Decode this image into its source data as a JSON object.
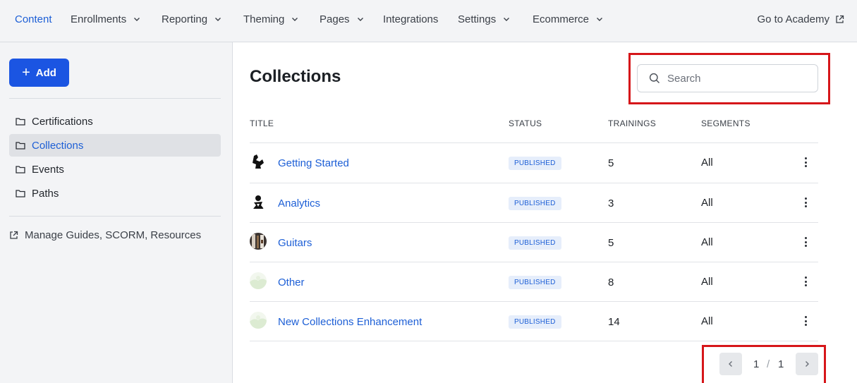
{
  "nav": {
    "items": [
      {
        "label": "Content",
        "active": true,
        "dropdown": false
      },
      {
        "label": "Enrollments",
        "dropdown": true
      },
      {
        "label": "Reporting",
        "dropdown": true
      },
      {
        "label": "Theming",
        "dropdown": true
      },
      {
        "label": "Pages",
        "dropdown": true
      },
      {
        "label": "Integrations",
        "dropdown": false
      },
      {
        "label": "Settings",
        "dropdown": true
      },
      {
        "label": "Ecommerce",
        "dropdown": true
      }
    ],
    "external_link": "Go to Academy"
  },
  "sidebar": {
    "add_label": "Add",
    "items": [
      {
        "label": "Certifications",
        "active": false
      },
      {
        "label": "Collections",
        "active": true
      },
      {
        "label": "Events",
        "active": false
      },
      {
        "label": "Paths",
        "active": false
      }
    ],
    "link_label": "Manage Guides, SCORM, Resources"
  },
  "main": {
    "title": "Collections",
    "search": {
      "placeholder": "Search",
      "value": ""
    },
    "columns": [
      "TITLE",
      "STATUS",
      "TRAININGS",
      "SEGMENTS"
    ],
    "rows": [
      {
        "title": "Getting Started",
        "status": "PUBLISHED",
        "trainings": "5",
        "segments": "All",
        "thumb": "bw-figure"
      },
      {
        "title": "Analytics",
        "status": "PUBLISHED",
        "trainings": "3",
        "segments": "All",
        "thumb": "bw-figure"
      },
      {
        "title": "Guitars",
        "status": "PUBLISHED",
        "trainings": "5",
        "segments": "All",
        "thumb": "guitars"
      },
      {
        "title": "Other",
        "status": "PUBLISHED",
        "trainings": "8",
        "segments": "All",
        "thumb": "faded-green"
      },
      {
        "title": "New Collections Enhancement",
        "status": "PUBLISHED",
        "trainings": "14",
        "segments": "All",
        "thumb": "faded-green"
      }
    ],
    "pagination": {
      "current": "1",
      "separator": "/",
      "total": "1"
    }
  },
  "colors": {
    "accent": "#1b55e2",
    "link": "#1d5fd6",
    "highlight": "#d6161a",
    "badge_bg": "#e6eefb"
  }
}
